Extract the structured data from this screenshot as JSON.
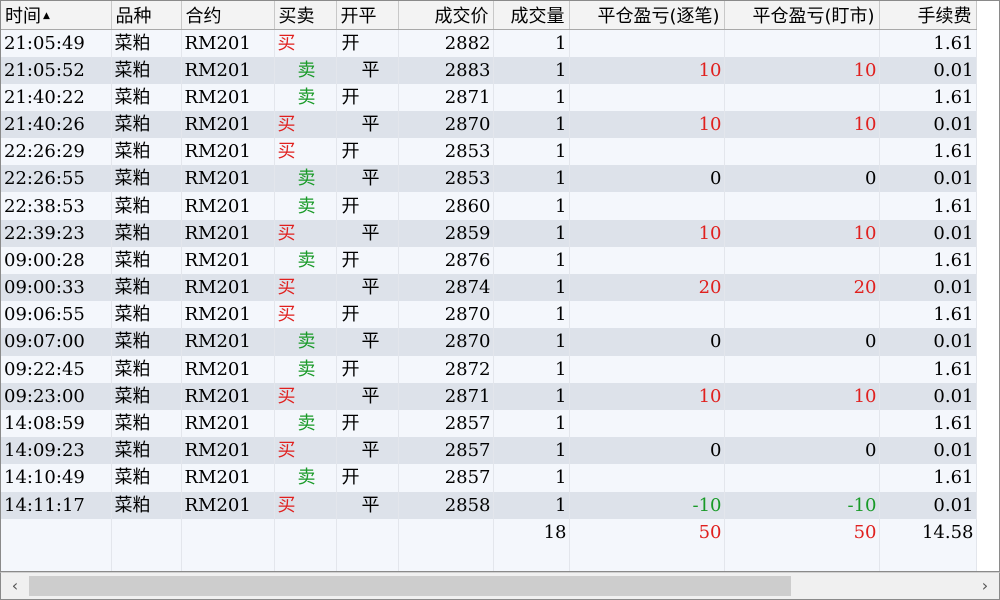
{
  "columns": [
    {
      "label": "时间",
      "sort": "▲"
    },
    {
      "label": "品种"
    },
    {
      "label": "合约"
    },
    {
      "label": "买卖"
    },
    {
      "label": "开平"
    },
    {
      "label": "成交价"
    },
    {
      "label": "成交量"
    },
    {
      "label": "平仓盈亏(逐笔)"
    },
    {
      "label": "平仓盈亏(盯市)"
    },
    {
      "label": "手续费"
    }
  ],
  "rows": [
    {
      "time": "21:05:49",
      "variety": "菜粕",
      "contract": "RM201",
      "side": "买",
      "offset": "开",
      "price": "2882",
      "volume": "1",
      "pnl_trade": "",
      "pnl_mtm": "",
      "fee": "1.61"
    },
    {
      "time": "21:05:52",
      "variety": "菜粕",
      "contract": "RM201",
      "side": "卖",
      "offset": "平",
      "price": "2883",
      "volume": "1",
      "pnl_trade": "10",
      "pnl_mtm": "10",
      "fee": "0.01"
    },
    {
      "time": "21:40:22",
      "variety": "菜粕",
      "contract": "RM201",
      "side": "卖",
      "offset": "开",
      "price": "2871",
      "volume": "1",
      "pnl_trade": "",
      "pnl_mtm": "",
      "fee": "1.61"
    },
    {
      "time": "21:40:26",
      "variety": "菜粕",
      "contract": "RM201",
      "side": "买",
      "offset": "平",
      "price": "2870",
      "volume": "1",
      "pnl_trade": "10",
      "pnl_mtm": "10",
      "fee": "0.01"
    },
    {
      "time": "22:26:29",
      "variety": "菜粕",
      "contract": "RM201",
      "side": "买",
      "offset": "开",
      "price": "2853",
      "volume": "1",
      "pnl_trade": "",
      "pnl_mtm": "",
      "fee": "1.61"
    },
    {
      "time": "22:26:55",
      "variety": "菜粕",
      "contract": "RM201",
      "side": "卖",
      "offset": "平",
      "price": "2853",
      "volume": "1",
      "pnl_trade": "0",
      "pnl_mtm": "0",
      "fee": "0.01"
    },
    {
      "time": "22:38:53",
      "variety": "菜粕",
      "contract": "RM201",
      "side": "卖",
      "offset": "开",
      "price": "2860",
      "volume": "1",
      "pnl_trade": "",
      "pnl_mtm": "",
      "fee": "1.61"
    },
    {
      "time": "22:39:23",
      "variety": "菜粕",
      "contract": "RM201",
      "side": "买",
      "offset": "平",
      "price": "2859",
      "volume": "1",
      "pnl_trade": "10",
      "pnl_mtm": "10",
      "fee": "0.01"
    },
    {
      "time": "09:00:28",
      "variety": "菜粕",
      "contract": "RM201",
      "side": "卖",
      "offset": "开",
      "price": "2876",
      "volume": "1",
      "pnl_trade": "",
      "pnl_mtm": "",
      "fee": "1.61"
    },
    {
      "time": "09:00:33",
      "variety": "菜粕",
      "contract": "RM201",
      "side": "买",
      "offset": "平",
      "price": "2874",
      "volume": "1",
      "pnl_trade": "20",
      "pnl_mtm": "20",
      "fee": "0.01"
    },
    {
      "time": "09:06:55",
      "variety": "菜粕",
      "contract": "RM201",
      "side": "买",
      "offset": "开",
      "price": "2870",
      "volume": "1",
      "pnl_trade": "",
      "pnl_mtm": "",
      "fee": "1.61"
    },
    {
      "time": "09:07:00",
      "variety": "菜粕",
      "contract": "RM201",
      "side": "卖",
      "offset": "平",
      "price": "2870",
      "volume": "1",
      "pnl_trade": "0",
      "pnl_mtm": "0",
      "fee": "0.01"
    },
    {
      "time": "09:22:45",
      "variety": "菜粕",
      "contract": "RM201",
      "side": "卖",
      "offset": "开",
      "price": "2872",
      "volume": "1",
      "pnl_trade": "",
      "pnl_mtm": "",
      "fee": "1.61"
    },
    {
      "time": "09:23:00",
      "variety": "菜粕",
      "contract": "RM201",
      "side": "买",
      "offset": "平",
      "price": "2871",
      "volume": "1",
      "pnl_trade": "10",
      "pnl_mtm": "10",
      "fee": "0.01"
    },
    {
      "time": "14:08:59",
      "variety": "菜粕",
      "contract": "RM201",
      "side": "卖",
      "offset": "开",
      "price": "2857",
      "volume": "1",
      "pnl_trade": "",
      "pnl_mtm": "",
      "fee": "1.61"
    },
    {
      "time": "14:09:23",
      "variety": "菜粕",
      "contract": "RM201",
      "side": "买",
      "offset": "平",
      "price": "2857",
      "volume": "1",
      "pnl_trade": "0",
      "pnl_mtm": "0",
      "fee": "0.01"
    },
    {
      "time": "14:10:49",
      "variety": "菜粕",
      "contract": "RM201",
      "side": "卖",
      "offset": "开",
      "price": "2857",
      "volume": "1",
      "pnl_trade": "",
      "pnl_mtm": "",
      "fee": "1.61"
    },
    {
      "time": "14:11:17",
      "variety": "菜粕",
      "contract": "RM201",
      "side": "买",
      "offset": "平",
      "price": "2858",
      "volume": "1",
      "pnl_trade": "-10",
      "pnl_mtm": "-10",
      "fee": "0.01"
    }
  ],
  "totals": {
    "volume": "18",
    "pnl_trade": "50",
    "pnl_mtm": "50",
    "fee": "14.58"
  },
  "scrollbar": {
    "left_arrow": "‹",
    "right_arrow": "›"
  },
  "colors": {
    "buy": "#e0201e",
    "sell": "#199a28",
    "profit": "#e0201e",
    "loss": "#199a28"
  }
}
